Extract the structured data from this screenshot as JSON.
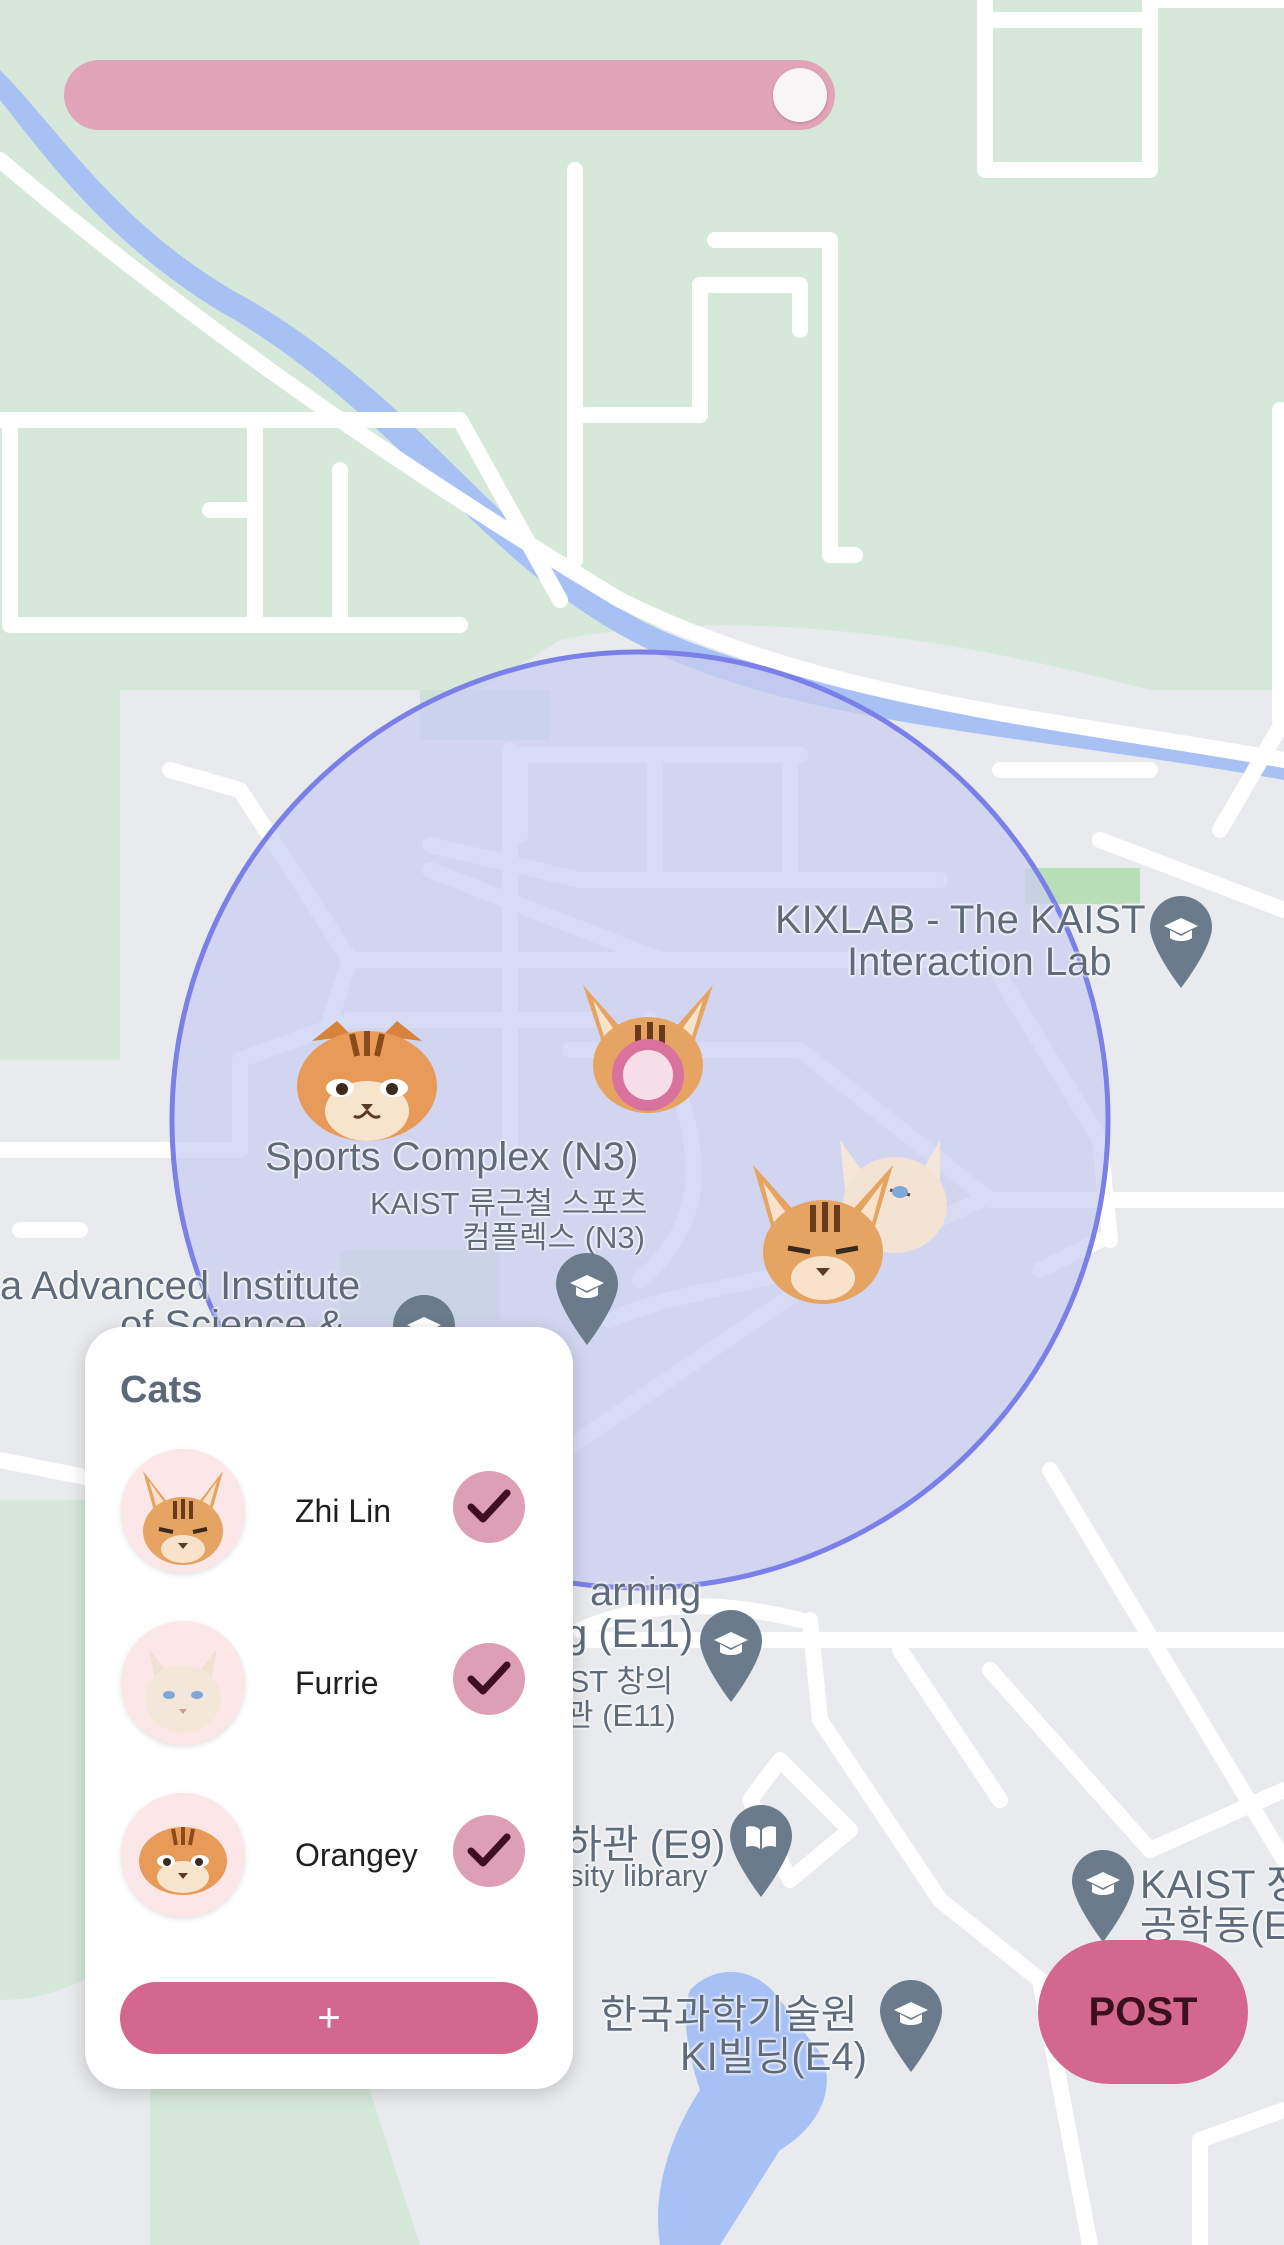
{
  "map": {
    "labels": {
      "kixlab_line1": "KIXLAB - The KAIST",
      "kixlab_line2": "Interaction Lab",
      "sports_en": "Sports Complex (N3)",
      "sports_ko1": "KAIST 류근철 스포츠",
      "sports_ko2": "컴플렉스 (N3)",
      "institute_line1": "a Advanced Institute",
      "institute_line2": "of Science &",
      "learning_line1": "arning",
      "learning_line2": "g (E11)",
      "learning_line3": "IST 창의",
      "learning_line4": "관 (E11)",
      "library_line1": "하관 (E9)",
      "library_line2": "sity library",
      "kaist_right_line1": "KAIST 정",
      "kaist_right_line2": "공학동(E",
      "ki_line1": "한국과학기술원",
      "ki_line2": "KI빌딩(E4)"
    },
    "markers": [
      "Orangey",
      "Zhi Lin",
      "Furrie"
    ],
    "radius_fill_color": "#c9cdf0",
    "radius_stroke_color": "#7b7fe8"
  },
  "slider": {
    "value": 1.0,
    "color": "#e2a4b8"
  },
  "panel": {
    "title": "Cats",
    "cats": [
      {
        "name": "Zhi Lin",
        "checked": true,
        "icon": "abyssinian-cat-icon"
      },
      {
        "name": "Furrie",
        "checked": true,
        "icon": "white-cat-icon"
      },
      {
        "name": "Orangey",
        "checked": true,
        "icon": "scottish-fold-cat-icon"
      }
    ],
    "add_label": "+"
  },
  "post_button": {
    "label": "POST",
    "color": "#d3678d"
  }
}
